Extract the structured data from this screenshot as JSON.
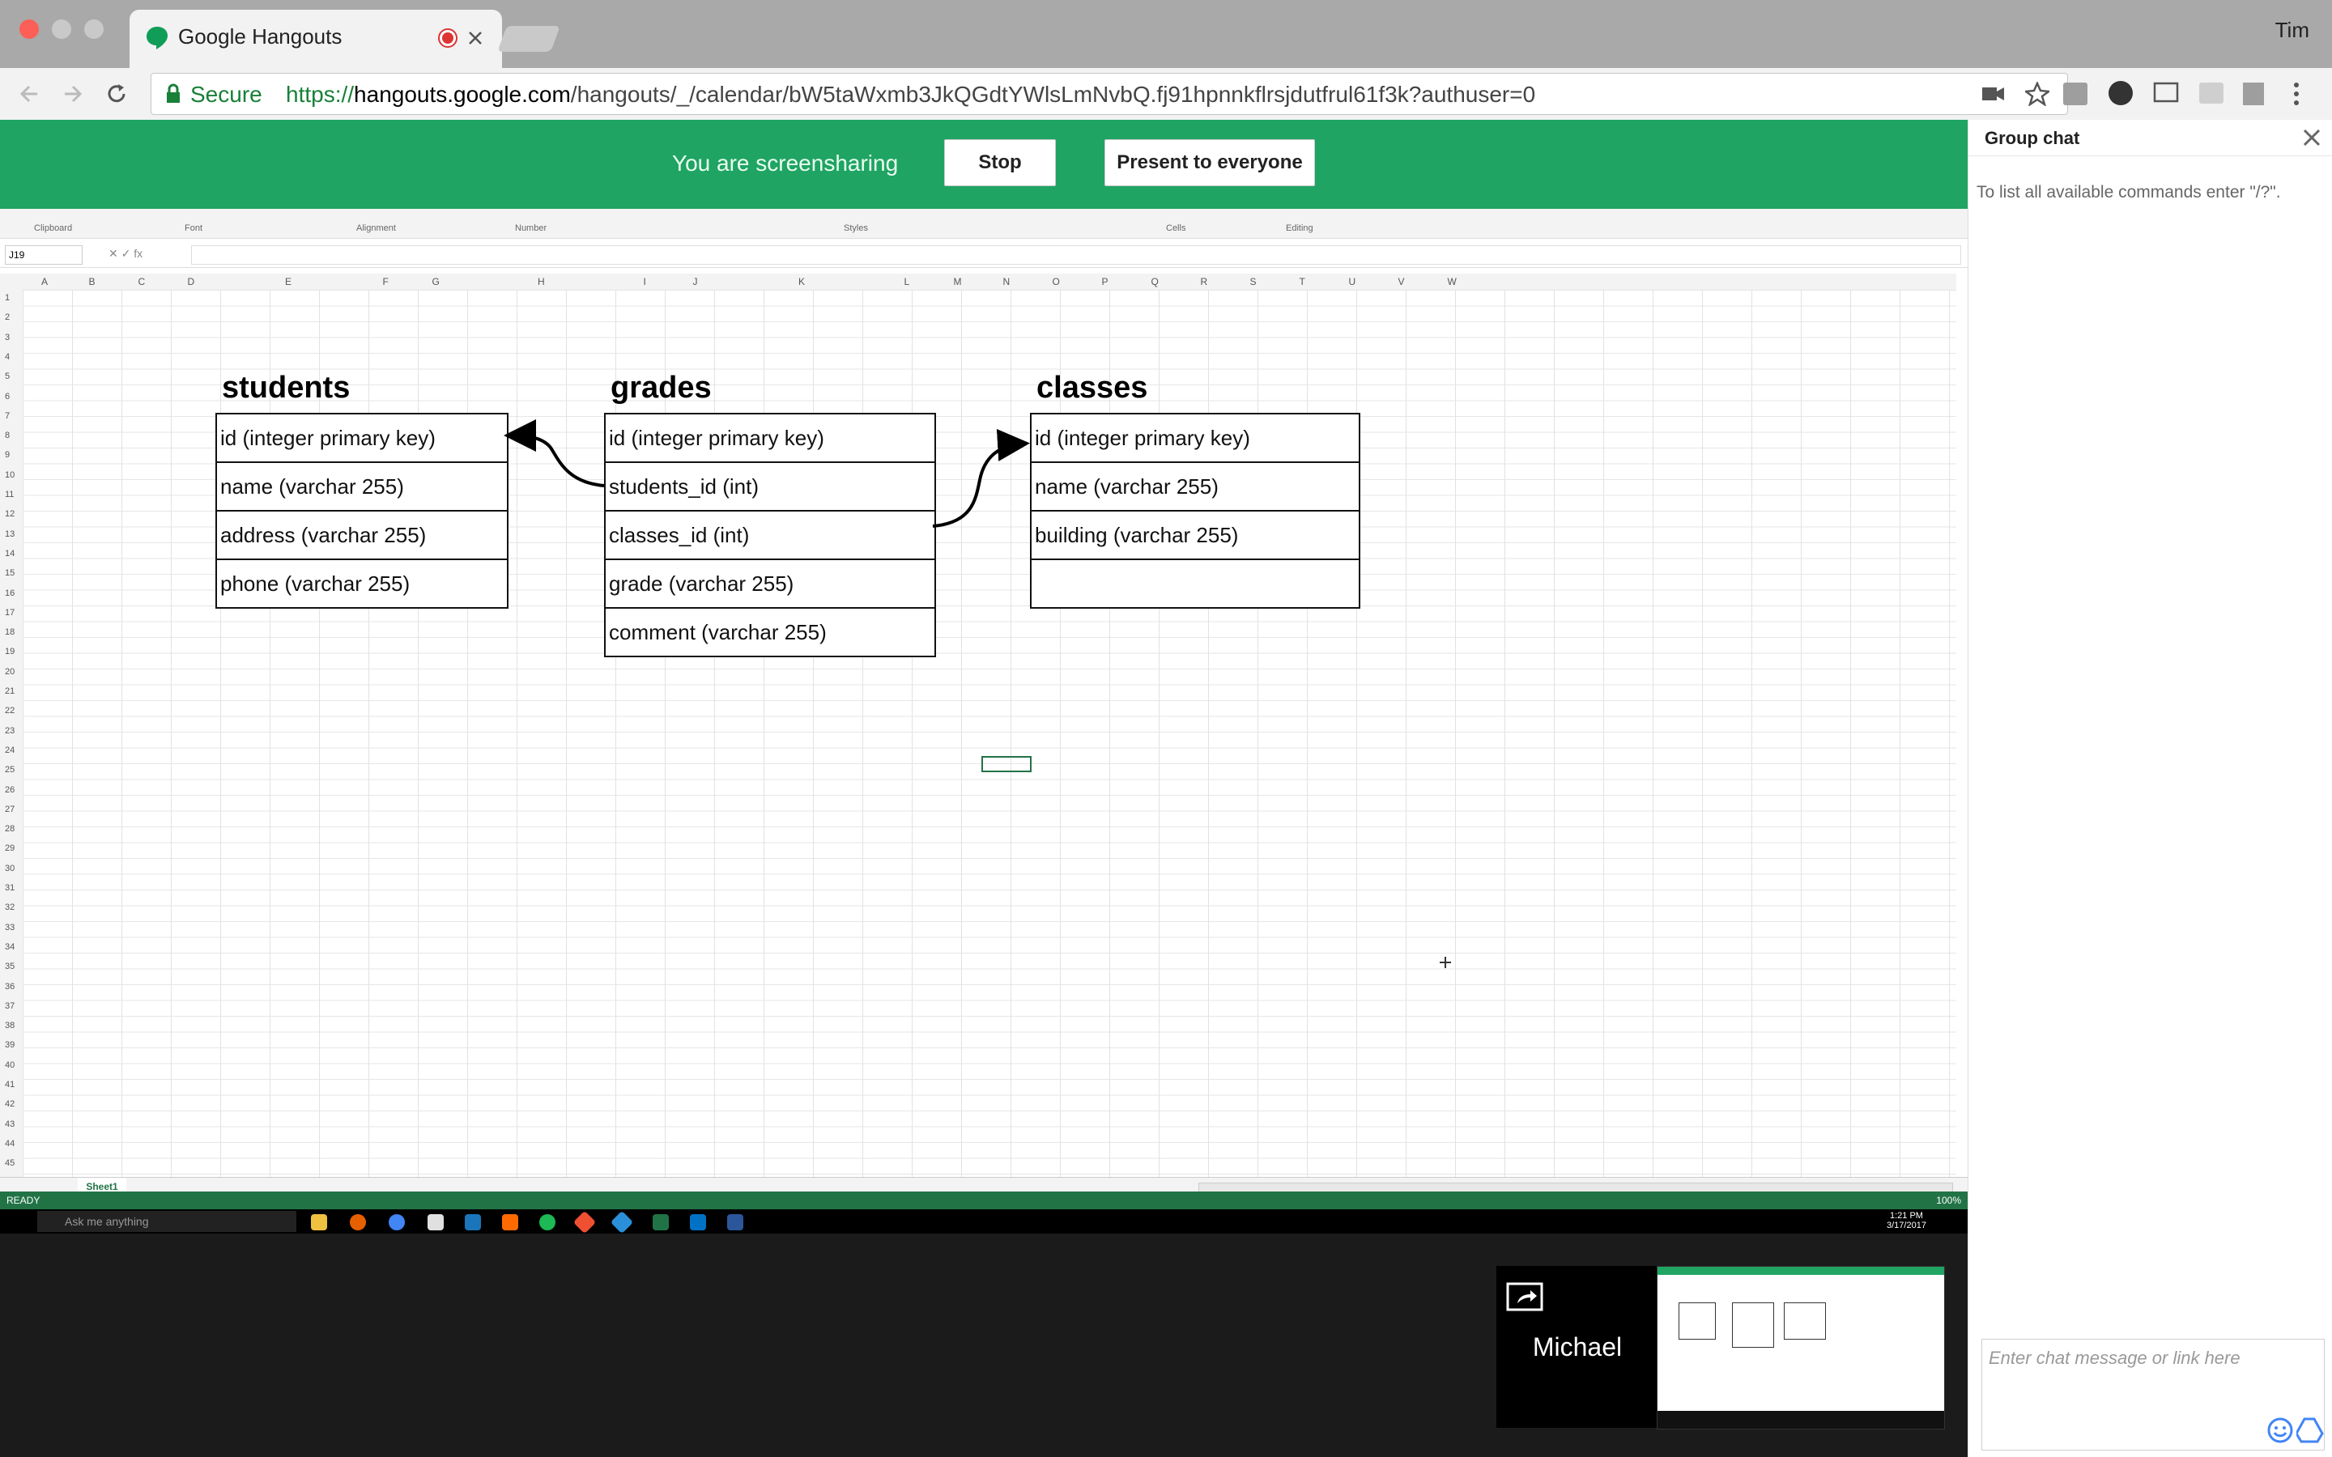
{
  "browser": {
    "tab_title": "Google Hangouts",
    "user_name": "Tim",
    "secure_label": "Secure",
    "url_prefix": "https://",
    "url_host": "hangouts.google.com",
    "url_path": "/hangouts/_/calendar/bW5taWxmb3JkQGdtYWlsLmNvbQ.fj91hpnnkflrsjdutfrul61f3k?authuser=0"
  },
  "screenshare": {
    "message": "You are screensharing",
    "stop_label": "Stop",
    "present_label": "Present to everyone"
  },
  "excel": {
    "name_box": "J19",
    "ribbon": [
      "Clipboard",
      "Font",
      "Alignment",
      "Number",
      "Styles",
      "Cells",
      "Editing"
    ],
    "columns": [
      "A",
      "B",
      "C",
      "D",
      "E",
      "F",
      "G",
      "H",
      "I",
      "J",
      "K",
      "L",
      "M",
      "N",
      "O",
      "P",
      "Q",
      "R",
      "S",
      "T",
      "U",
      "V",
      "W"
    ],
    "sheet_tab": "Sheet1",
    "status": "READY",
    "zoom": "100%",
    "taskbar_search": "Ask me anything",
    "clock_time": "1:21 PM",
    "clock_date": "3/17/2017",
    "tables": {
      "students": {
        "title": "students",
        "rows": [
          "id (integer primary key)",
          "name (varchar 255)",
          "address (varchar 255)",
          "phone (varchar 255)"
        ]
      },
      "grades": {
        "title": "grades",
        "rows": [
          "id (integer primary key)",
          "students_id (int)",
          "classes_id (int)",
          "grade (varchar 255)",
          "comment (varchar 255)"
        ]
      },
      "classes": {
        "title": "classes",
        "rows": [
          "id (integer primary key)",
          "name (varchar 255)",
          "building (varchar 255)",
          ""
        ]
      }
    }
  },
  "participant": {
    "name": "Michael"
  },
  "chat": {
    "title": "Group chat",
    "help_text": "To list all available commands enter \"/?\".",
    "input_placeholder": "Enter chat message or link here"
  },
  "colors": {
    "hangouts_green": "#1fa463",
    "excel_green": "#217346"
  }
}
